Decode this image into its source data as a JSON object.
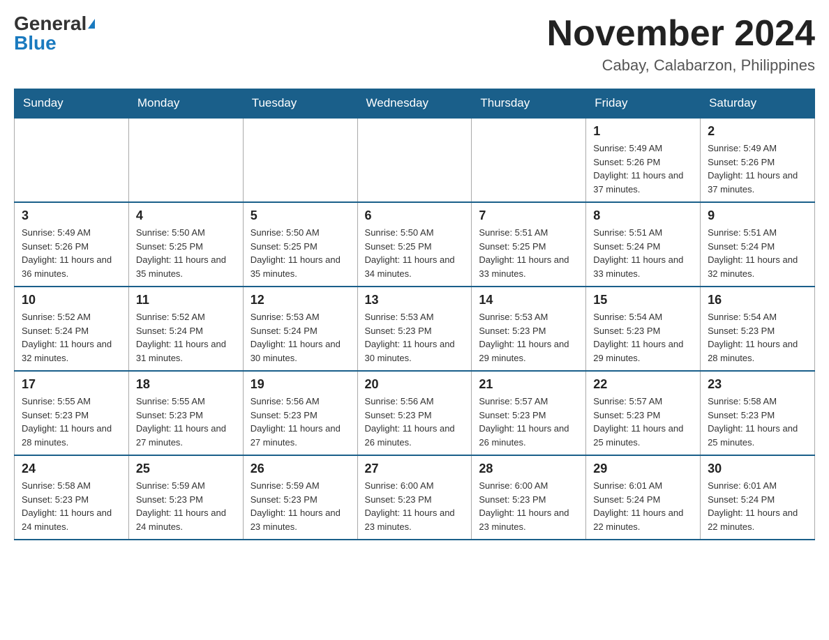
{
  "header": {
    "logo_general": "General",
    "logo_blue": "Blue",
    "title": "November 2024",
    "subtitle": "Cabay, Calabarzon, Philippines"
  },
  "days_of_week": [
    "Sunday",
    "Monday",
    "Tuesday",
    "Wednesday",
    "Thursday",
    "Friday",
    "Saturday"
  ],
  "weeks": [
    [
      {
        "day": "",
        "info": ""
      },
      {
        "day": "",
        "info": ""
      },
      {
        "day": "",
        "info": ""
      },
      {
        "day": "",
        "info": ""
      },
      {
        "day": "",
        "info": ""
      },
      {
        "day": "1",
        "info": "Sunrise: 5:49 AM\nSunset: 5:26 PM\nDaylight: 11 hours and 37 minutes."
      },
      {
        "day": "2",
        "info": "Sunrise: 5:49 AM\nSunset: 5:26 PM\nDaylight: 11 hours and 37 minutes."
      }
    ],
    [
      {
        "day": "3",
        "info": "Sunrise: 5:49 AM\nSunset: 5:26 PM\nDaylight: 11 hours and 36 minutes."
      },
      {
        "day": "4",
        "info": "Sunrise: 5:50 AM\nSunset: 5:25 PM\nDaylight: 11 hours and 35 minutes."
      },
      {
        "day": "5",
        "info": "Sunrise: 5:50 AM\nSunset: 5:25 PM\nDaylight: 11 hours and 35 minutes."
      },
      {
        "day": "6",
        "info": "Sunrise: 5:50 AM\nSunset: 5:25 PM\nDaylight: 11 hours and 34 minutes."
      },
      {
        "day": "7",
        "info": "Sunrise: 5:51 AM\nSunset: 5:25 PM\nDaylight: 11 hours and 33 minutes."
      },
      {
        "day": "8",
        "info": "Sunrise: 5:51 AM\nSunset: 5:24 PM\nDaylight: 11 hours and 33 minutes."
      },
      {
        "day": "9",
        "info": "Sunrise: 5:51 AM\nSunset: 5:24 PM\nDaylight: 11 hours and 32 minutes."
      }
    ],
    [
      {
        "day": "10",
        "info": "Sunrise: 5:52 AM\nSunset: 5:24 PM\nDaylight: 11 hours and 32 minutes."
      },
      {
        "day": "11",
        "info": "Sunrise: 5:52 AM\nSunset: 5:24 PM\nDaylight: 11 hours and 31 minutes."
      },
      {
        "day": "12",
        "info": "Sunrise: 5:53 AM\nSunset: 5:24 PM\nDaylight: 11 hours and 30 minutes."
      },
      {
        "day": "13",
        "info": "Sunrise: 5:53 AM\nSunset: 5:23 PM\nDaylight: 11 hours and 30 minutes."
      },
      {
        "day": "14",
        "info": "Sunrise: 5:53 AM\nSunset: 5:23 PM\nDaylight: 11 hours and 29 minutes."
      },
      {
        "day": "15",
        "info": "Sunrise: 5:54 AM\nSunset: 5:23 PM\nDaylight: 11 hours and 29 minutes."
      },
      {
        "day": "16",
        "info": "Sunrise: 5:54 AM\nSunset: 5:23 PM\nDaylight: 11 hours and 28 minutes."
      }
    ],
    [
      {
        "day": "17",
        "info": "Sunrise: 5:55 AM\nSunset: 5:23 PM\nDaylight: 11 hours and 28 minutes."
      },
      {
        "day": "18",
        "info": "Sunrise: 5:55 AM\nSunset: 5:23 PM\nDaylight: 11 hours and 27 minutes."
      },
      {
        "day": "19",
        "info": "Sunrise: 5:56 AM\nSunset: 5:23 PM\nDaylight: 11 hours and 27 minutes."
      },
      {
        "day": "20",
        "info": "Sunrise: 5:56 AM\nSunset: 5:23 PM\nDaylight: 11 hours and 26 minutes."
      },
      {
        "day": "21",
        "info": "Sunrise: 5:57 AM\nSunset: 5:23 PM\nDaylight: 11 hours and 26 minutes."
      },
      {
        "day": "22",
        "info": "Sunrise: 5:57 AM\nSunset: 5:23 PM\nDaylight: 11 hours and 25 minutes."
      },
      {
        "day": "23",
        "info": "Sunrise: 5:58 AM\nSunset: 5:23 PM\nDaylight: 11 hours and 25 minutes."
      }
    ],
    [
      {
        "day": "24",
        "info": "Sunrise: 5:58 AM\nSunset: 5:23 PM\nDaylight: 11 hours and 24 minutes."
      },
      {
        "day": "25",
        "info": "Sunrise: 5:59 AM\nSunset: 5:23 PM\nDaylight: 11 hours and 24 minutes."
      },
      {
        "day": "26",
        "info": "Sunrise: 5:59 AM\nSunset: 5:23 PM\nDaylight: 11 hours and 23 minutes."
      },
      {
        "day": "27",
        "info": "Sunrise: 6:00 AM\nSunset: 5:23 PM\nDaylight: 11 hours and 23 minutes."
      },
      {
        "day": "28",
        "info": "Sunrise: 6:00 AM\nSunset: 5:23 PM\nDaylight: 11 hours and 23 minutes."
      },
      {
        "day": "29",
        "info": "Sunrise: 6:01 AM\nSunset: 5:24 PM\nDaylight: 11 hours and 22 minutes."
      },
      {
        "day": "30",
        "info": "Sunrise: 6:01 AM\nSunset: 5:24 PM\nDaylight: 11 hours and 22 minutes."
      }
    ]
  ]
}
